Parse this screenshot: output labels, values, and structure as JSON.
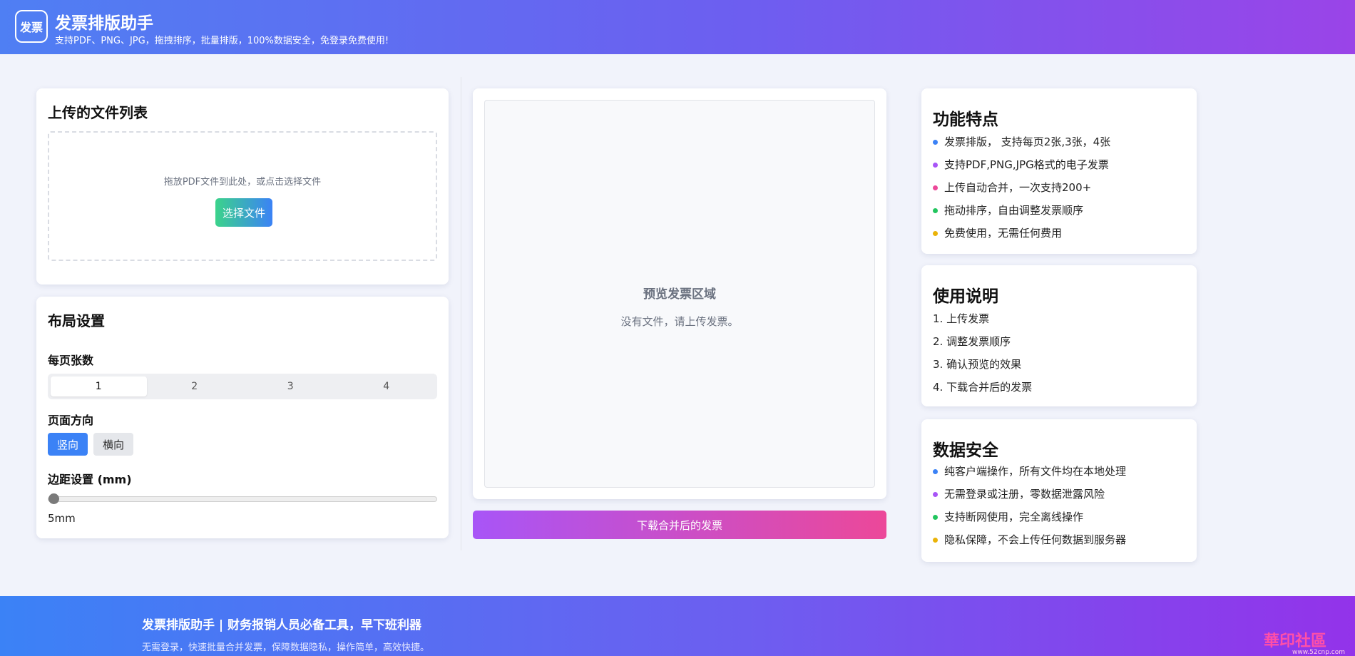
{
  "header": {
    "logo_text": "发票",
    "title": "发票排版助手",
    "subtitle": "支持PDF、PNG、JPG，拖拽排序，批量排版，100%数据安全，免登录免费使用!"
  },
  "upload": {
    "title": "上传的文件列表",
    "hint": "拖放PDF文件到此处，或点击选择文件",
    "button": "选择文件"
  },
  "layout": {
    "title": "布局设置",
    "per_page_label": "每页张数",
    "per_page_options": [
      "1",
      "2",
      "3",
      "4"
    ],
    "per_page_selected": "1",
    "orientation_label": "页面方向",
    "orientation_options": [
      "竖向",
      "横向"
    ],
    "orientation_selected": "竖向",
    "margin_label": "边距设置 (mm)",
    "margin_value": "5mm",
    "margin_numeric": 5
  },
  "preview": {
    "title": "预览发票区域",
    "empty_text": "没有文件，请上传发票。",
    "download_button": "下载合并后的发票"
  },
  "features": {
    "title": "功能特点",
    "items": [
      {
        "text": "发票排版， 支持每页2张,3张，4张",
        "color": "#3b82f6"
      },
      {
        "text": "支持PDF,PNG,JPG格式的电子发票",
        "color": "#a855f7"
      },
      {
        "text": "上传自动合并，一次支持200+",
        "color": "#ec4899"
      },
      {
        "text": "拖动排序，自由调整发票顺序",
        "color": "#22c55e"
      },
      {
        "text": "免费使用，无需任何费用",
        "color": "#eab308"
      }
    ]
  },
  "instructions": {
    "title": "使用说明",
    "items": [
      "1. 上传发票",
      "2. 调整发票顺序",
      "3. 确认预览的效果",
      "4. 下载合并后的发票"
    ]
  },
  "security": {
    "title": "数据安全",
    "items": [
      {
        "text": "纯客户端操作，所有文件均在本地处理",
        "color": "#3b82f6"
      },
      {
        "text": "无需登录或注册，零数据泄露风险",
        "color": "#a855f7"
      },
      {
        "text": "支持断网使用，完全离线操作",
        "color": "#22c55e"
      },
      {
        "text": "隐私保障，不会上传任何数据到服务器",
        "color": "#eab308"
      }
    ]
  },
  "footer": {
    "title": "发票排版助手 | 财务报销人员必备工具，早下班利器",
    "subtitle": "无需登录，快速批量合并发票，保障数据隐私，操作简单，高效快捷。",
    "watermark": "華印社區",
    "watermark_sub": "www.52cnp.com"
  }
}
